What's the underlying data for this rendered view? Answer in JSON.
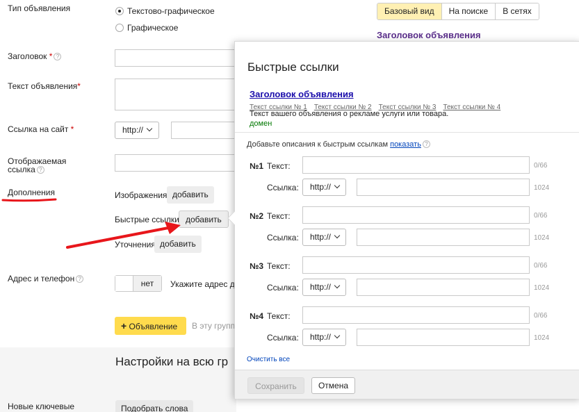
{
  "form": {
    "ad_type_label": "Тип объявления",
    "ad_type_options": [
      "Текстово-графическое",
      "Графическое"
    ],
    "title_label": "Заголовок",
    "text_label": "Текст объявления",
    "site_link_label": "Ссылка на сайт",
    "protocol": "http://",
    "display_link_label_1": "Отображаемая",
    "display_link_label_2": "ссылка",
    "extras_label": "Дополнения",
    "images_label": "Изображения",
    "quick_links_label": "Быстрые ссылки",
    "clarifications_label": "Уточнения",
    "add_label": "добавить",
    "address_label": "Адрес и телефон",
    "toggle_no": "нет",
    "address_hint": "Укажите адрес д",
    "add_ad_button": "Объявление",
    "group_hint": "В эту групп",
    "settings_heading": "Настройки на всю гр",
    "new_keywords_label": "Новые ключевые",
    "pick_words_button": "Подобрать слова"
  },
  "preview_tabs": {
    "items": [
      "Базовый вид",
      "На поиске",
      "В сетях"
    ],
    "active": 0,
    "title": "Заголовок объявления"
  },
  "modal": {
    "title": "Быстрые ссылки",
    "preview_title": "Заголовок объявления",
    "preview_sublinks": [
      "Текст ссылки № 1",
      "Текст ссылки № 2",
      "Текст ссылки № 3",
      "Текст ссылки № 4"
    ],
    "preview_text": "Текст вашего объявления о рекламе услуги или товара.",
    "preview_domain": "домен",
    "descriptions_prompt": "Добавьте описания к быстрым ссылкам",
    "descriptions_show": "показать",
    "text_label": "Текст:",
    "link_label": "Ссылка:",
    "protocol": "http://",
    "text_limit": "0/66",
    "link_limit": "1024",
    "rows": [
      "№1",
      "№2",
      "№3",
      "№4"
    ],
    "clear_all": "Очистить все",
    "save_button": "Сохранить",
    "cancel_button": "Отмена"
  },
  "colors": {
    "accent_yellow": "#ffdb4d",
    "annotation_red": "#e8161b",
    "active_tab": "#fff0b3"
  }
}
